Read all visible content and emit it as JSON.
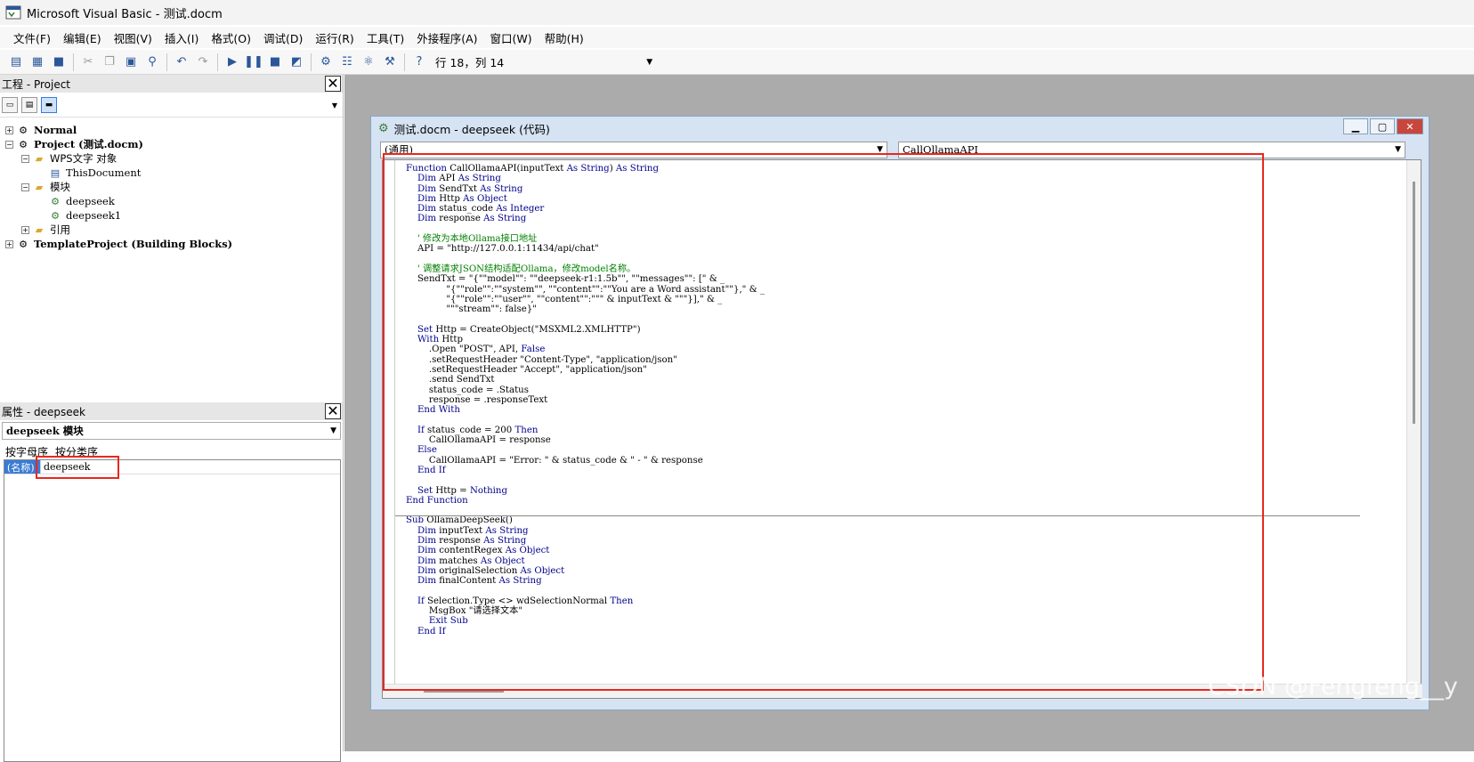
{
  "window": {
    "title": "Microsoft Visual Basic - 测试.docm"
  },
  "menu": [
    "文件(F)",
    "编辑(E)",
    "视图(V)",
    "插入(I)",
    "格式(O)",
    "调试(D)",
    "运行(R)",
    "工具(T)",
    "外接程序(A)",
    "窗口(W)",
    "帮助(H)"
  ],
  "toolbar": {
    "position": "行 18，列 14"
  },
  "project": {
    "title": "工程 - Project",
    "tree": {
      "normal": "Normal",
      "project": "Project (测试.docm)",
      "wps": "WPS文字 对象",
      "thisdoc": "ThisDocument",
      "modules": "模块",
      "deepseek": "deepseek",
      "deepseek1": "deepseek1",
      "refs": "引用",
      "template": "TemplateProject (Building Blocks)"
    }
  },
  "properties": {
    "title": "属性 - deepseek",
    "object": "deepseek 模块",
    "tab_alpha": "按字母序",
    "tab_cat": "按分类序",
    "name_key": "(名称)",
    "name_val": "deepseek"
  },
  "codewindow": {
    "title": "测试.docm - deepseek (代码)",
    "object_combo": "(通用)",
    "proc_combo": "CallOllamaAPI"
  },
  "watermark": "CSDN @Fengfeng__y",
  "colors": {
    "keyword": "#00008b",
    "comment": "#008000",
    "highlight": "#e8281e",
    "selection": "#3a7bd5"
  }
}
